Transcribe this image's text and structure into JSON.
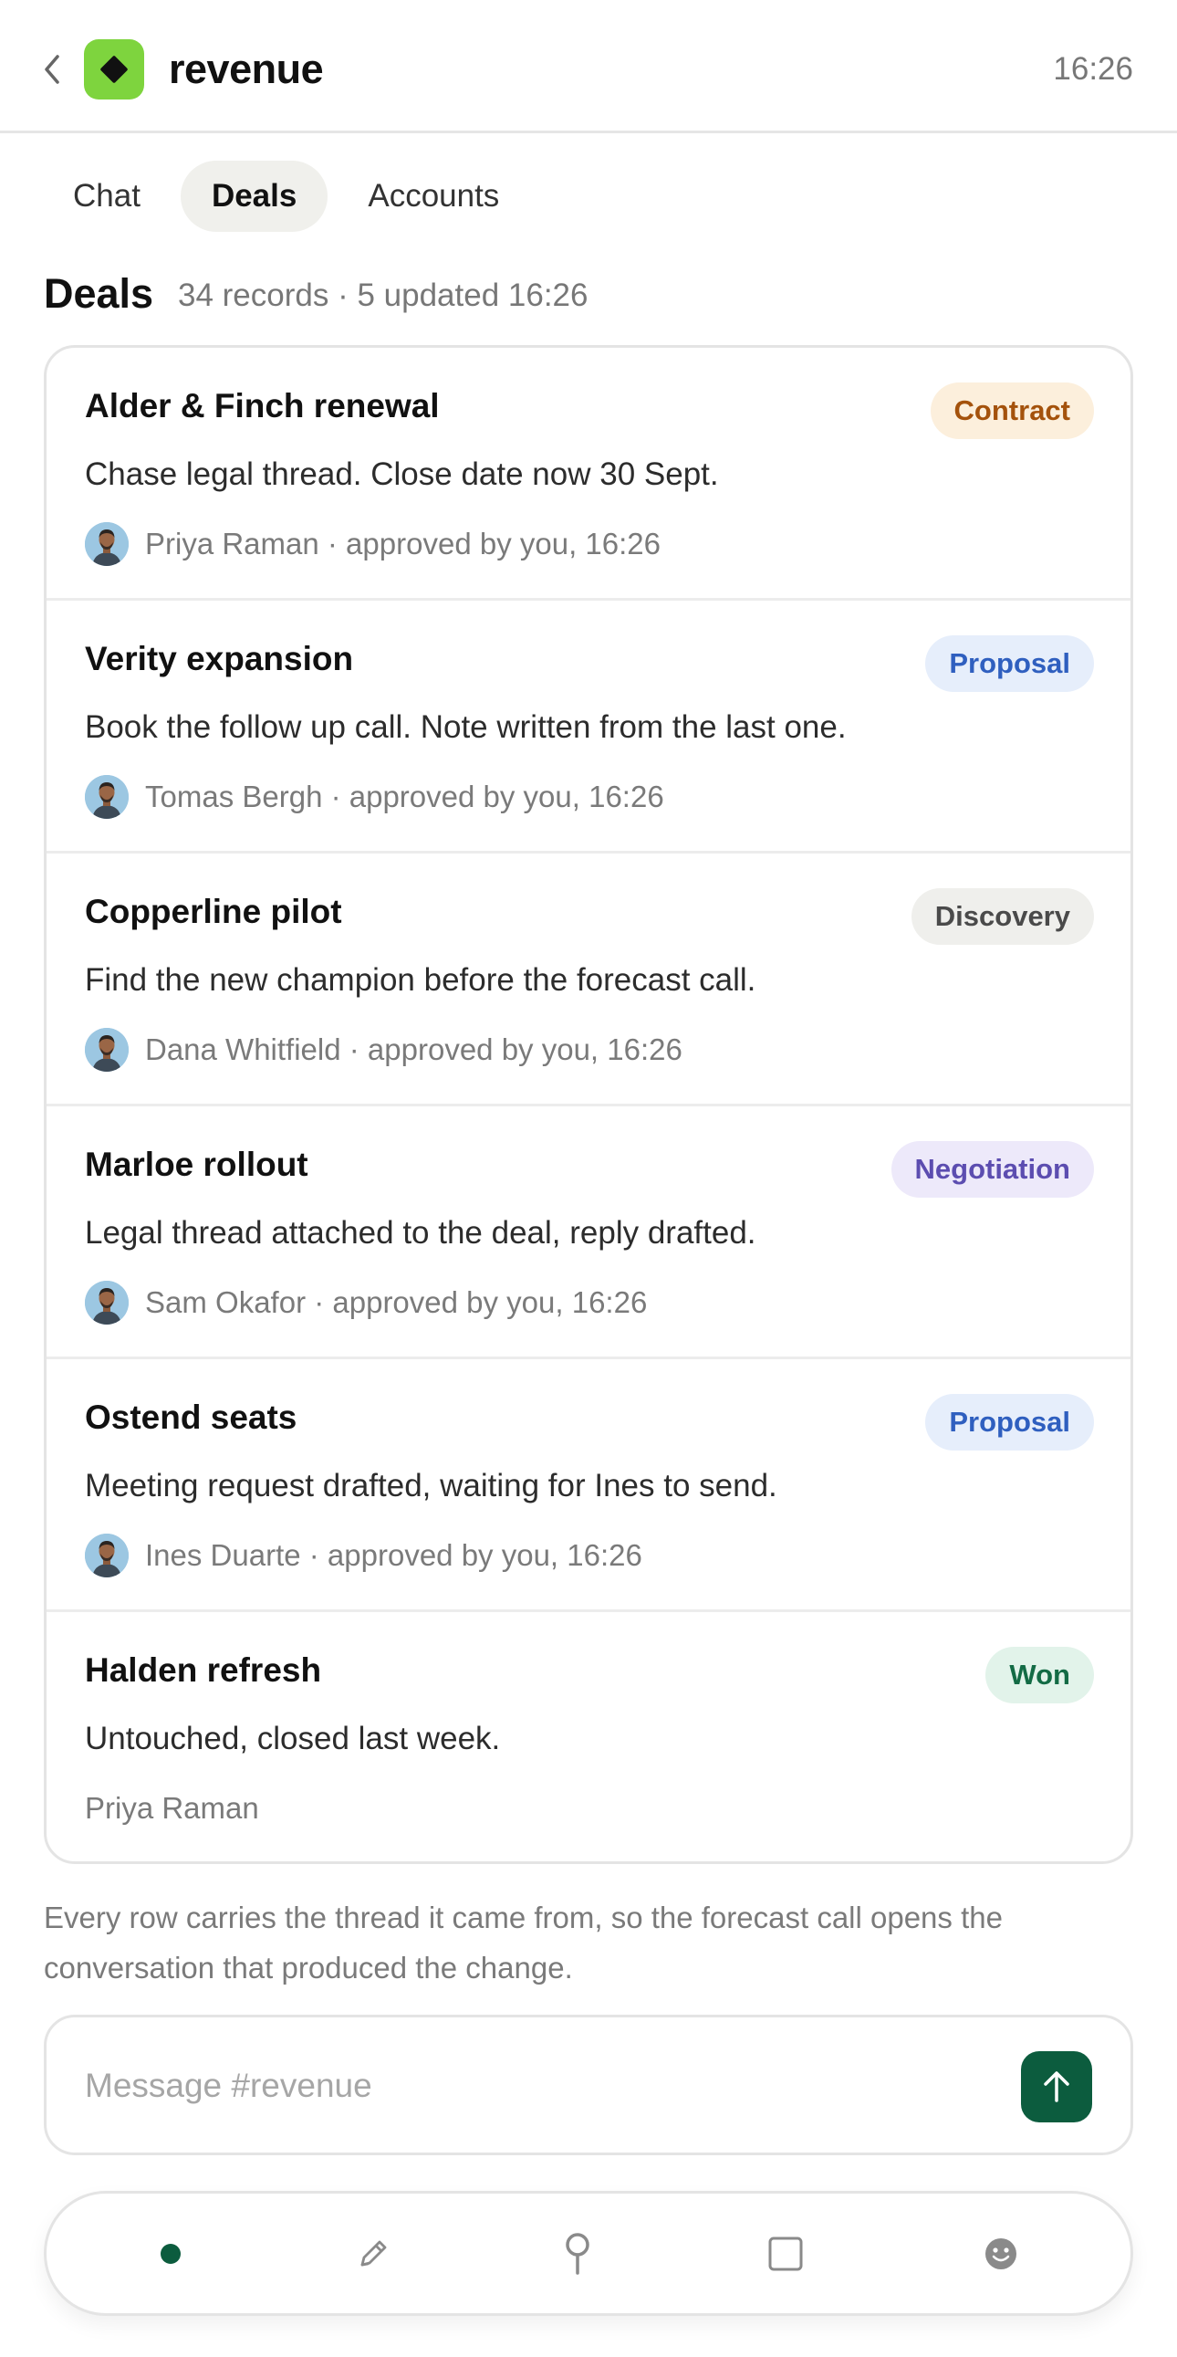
{
  "header": {
    "back_icon": "chevron-left-icon",
    "app_icon": "diamond-icon",
    "app_color": "#7ed43e",
    "channel": "revenue",
    "time": "16:26"
  },
  "tabs": [
    {
      "label": "Chat",
      "active": false
    },
    {
      "label": "Deals",
      "active": true
    },
    {
      "label": "Accounts",
      "active": false
    }
  ],
  "section": {
    "title": "Deals",
    "meta": "34 records · 5 updated 16:26"
  },
  "deals": [
    {
      "name": "Alder & Finch renewal",
      "stage": "Contract",
      "stage_color": "#a4520c",
      "stage_bg": "#fcefdc",
      "note": "Chase legal thread. Close date now 30 Sept.",
      "owner": "Priya Raman · approved by you, 16:26",
      "has_avatar": true
    },
    {
      "name": "Verity expansion",
      "stage": "Proposal",
      "stage_color": "#2f5fbf",
      "stage_bg": "#e6eefb",
      "note": "Book the follow up call. Note written from the last one.",
      "owner": "Tomas Bergh · approved by you, 16:26",
      "has_avatar": true
    },
    {
      "name": "Copperline pilot",
      "stage": "Discovery",
      "stage_color": "#4a4a4a",
      "stage_bg": "#efefec",
      "note": "Find the new champion before the forecast call.",
      "owner": "Dana Whitfield · approved by you, 16:26",
      "has_avatar": true
    },
    {
      "name": "Marloe rollout",
      "stage": "Negotiation",
      "stage_color": "#5c4db0",
      "stage_bg": "#ede9fa",
      "note": "Legal thread attached to the deal, reply drafted.",
      "owner": "Sam Okafor · approved by you, 16:26",
      "has_avatar": true
    },
    {
      "name": "Ostend seats",
      "stage": "Proposal",
      "stage_color": "#2f5fbf",
      "stage_bg": "#e6eefb",
      "note": "Meeting request drafted, waiting for Ines to send.",
      "owner": "Ines Duarte · approved by you, 16:26",
      "has_avatar": true
    },
    {
      "name": "Halden refresh",
      "stage": "Won",
      "stage_color": "#136b45",
      "stage_bg": "#e2f3ea",
      "note": "Untouched, closed last week.",
      "owner": "Priya Raman",
      "has_avatar": false
    }
  ],
  "footer_note": "Every row carries the thread it came from, so the forecast call opens the conversation that produced the change.",
  "composer": {
    "placeholder": "Message #revenue",
    "send_icon": "arrow-up-icon",
    "send_color": "#0c5c3e"
  },
  "bottom_nav": [
    {
      "icon": "dot-icon",
      "active": true
    },
    {
      "icon": "pencil-icon",
      "active": false
    },
    {
      "icon": "search-icon",
      "active": false
    },
    {
      "icon": "square-icon",
      "active": false
    },
    {
      "icon": "smiley-icon",
      "active": false
    }
  ]
}
